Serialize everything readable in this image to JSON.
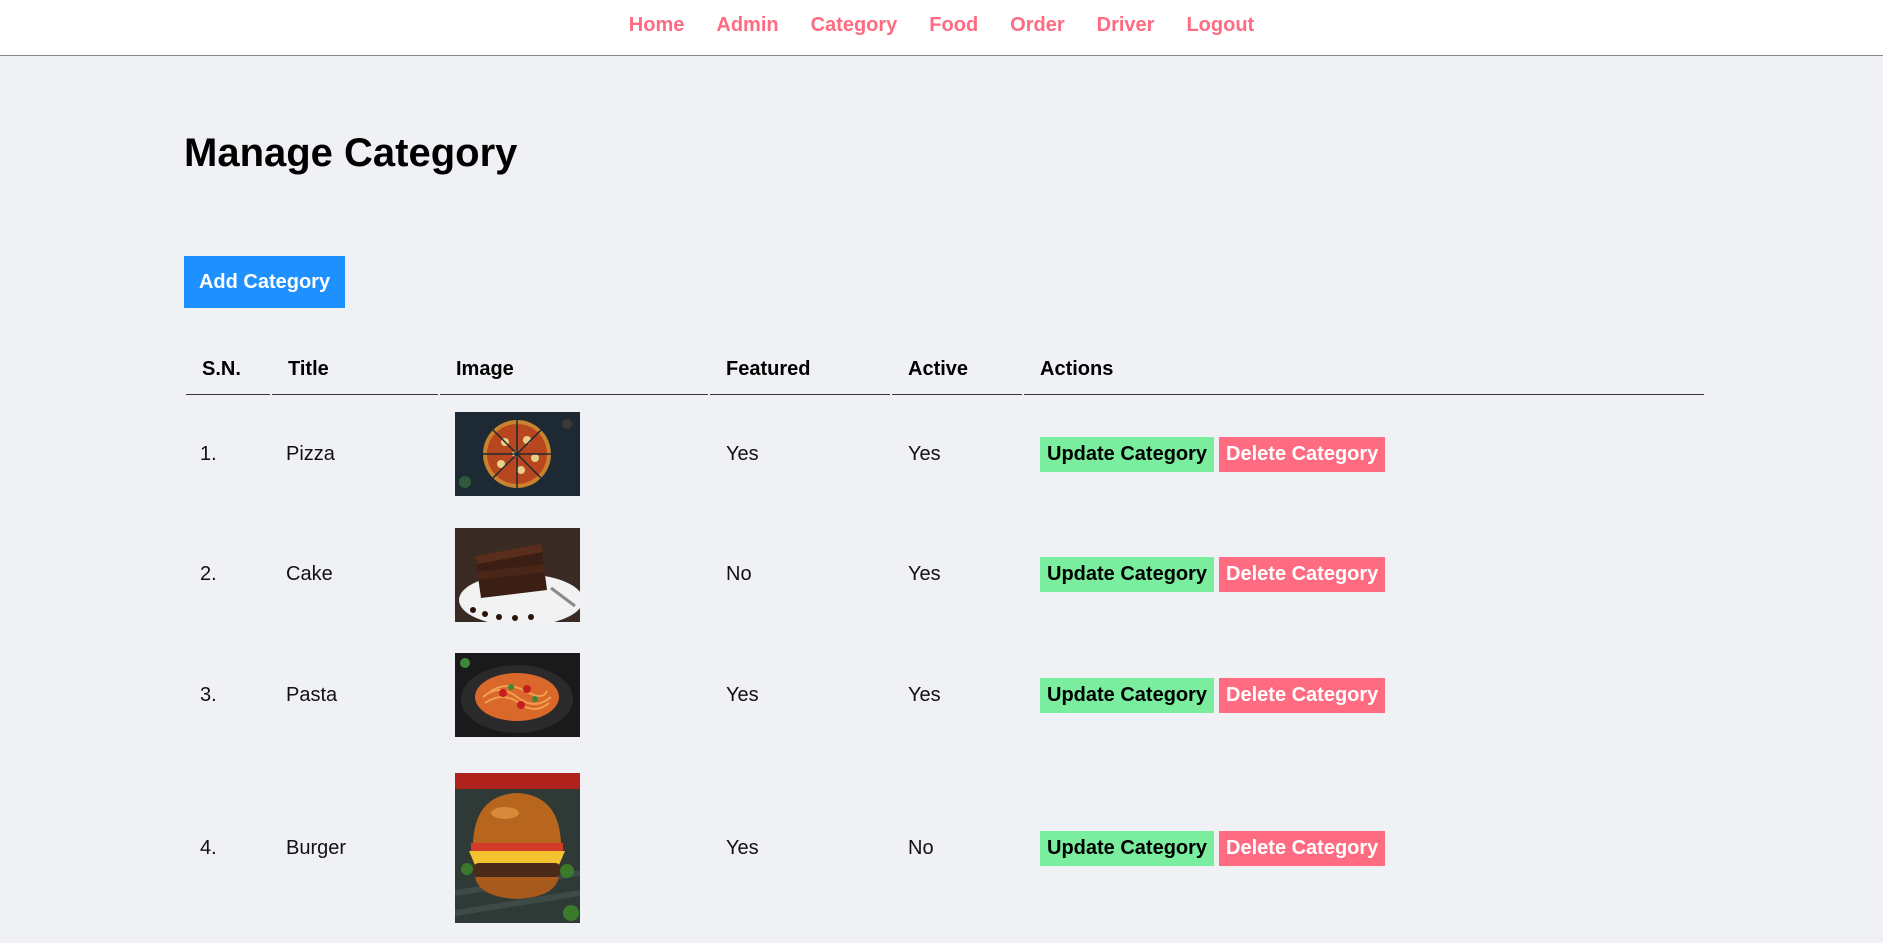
{
  "nav": {
    "items": [
      "Home",
      "Admin",
      "Category",
      "Food",
      "Order",
      "Driver",
      "Logout"
    ]
  },
  "page": {
    "title": "Manage Category",
    "add_button": "Add Category"
  },
  "table": {
    "headers": {
      "sn": "S.N.",
      "title": "Title",
      "image": "Image",
      "featured": "Featured",
      "active": "Active",
      "actions": "Actions"
    },
    "update_label": "Update Category",
    "delete_label": "Delete Category",
    "rows": [
      {
        "sn": "1.",
        "title": "Pizza",
        "image": "pizza-photo",
        "featured": "Yes",
        "active": "Yes"
      },
      {
        "sn": "2.",
        "title": "Cake",
        "image": "cake-photo",
        "featured": "No",
        "active": "Yes"
      },
      {
        "sn": "3.",
        "title": "Pasta",
        "image": "pasta-photo",
        "featured": "Yes",
        "active": "Yes"
      },
      {
        "sn": "4.",
        "title": "Burger",
        "image": "burger-photo",
        "featured": "Yes",
        "active": "No"
      }
    ]
  },
  "colors": {
    "nav_link": "#ff6b81",
    "add_button": "#1e90ff",
    "update_button": "#7bed9f",
    "delete_button": "#ff6b81",
    "background": "#f0f1f5"
  }
}
